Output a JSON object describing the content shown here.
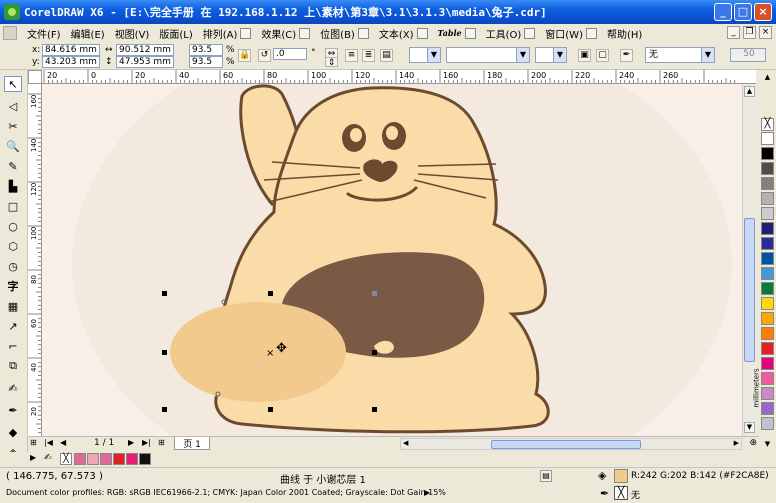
{
  "title": "CorelDRAW X6 - [E:\\完全手册 在 192.168.1.12 上\\素材\\第3章\\3.1\\3.1.3\\media\\兔子.cdr]",
  "window_buttons": {
    "minimize": "_",
    "maximize": "□",
    "close": "×"
  },
  "menu": [
    {
      "label": "文件(F)"
    },
    {
      "label": "编辑(E)"
    },
    {
      "label": "视图(V)"
    },
    {
      "label": "版面(L)"
    },
    {
      "label": "排列(A)"
    },
    {
      "label": "效果(C)"
    },
    {
      "label": "位图(B)"
    },
    {
      "label": "文本(X)"
    },
    {
      "label": "Table"
    },
    {
      "label": "工具(O)"
    },
    {
      "label": "窗口(W)"
    },
    {
      "label": "帮助(H)"
    }
  ],
  "propbar": {
    "x_label": "x:",
    "x_value": "84.616 mm",
    "y_label": "y:",
    "y_value": "43.203 mm",
    "w_value": "90.512 mm",
    "h_value": "47.953 mm",
    "scale_w": "93.5",
    "scale_h": "93.5",
    "percent": "%",
    "angle": ".0",
    "degree": "°",
    "outline_none": "无",
    "size_value": "50"
  },
  "ruler": {
    "h_ticks": [
      "20",
      "0",
      "20",
      "40",
      "60",
      "80",
      "100",
      "120",
      "140",
      "160",
      "180",
      "200",
      "220",
      "240",
      "260"
    ],
    "v_ticks": [
      "160",
      "140",
      "120",
      "100",
      "80",
      "60",
      "40",
      "20"
    ],
    "unit": "millimeters"
  },
  "pages": {
    "current": "1 / 1",
    "tab": "页 1"
  },
  "status": {
    "coords": "( 146.775, 67.573 )",
    "selection": "曲线 于 小谢芯层 1",
    "fill_info": "R:242 G:202 B:142 (#F2CA8E)",
    "outline_none": "无",
    "profile": "Document color profiles: RGB: sRGB IEC61966-2.1; CMYK: Japan Color 2001 Coated; Grayscale: Dot Gain 15%"
  },
  "colors": {
    "bunny_fill": "#f9dca7",
    "bunny_outline": "#6b4a2f",
    "belly": "#7a5a45",
    "selected_ellipse": "#f2ca8e",
    "paper_bg": "#f6ebe0",
    "titlebar": "#0d5fe0"
  },
  "palette_colors": [
    "#ffffff",
    "#000000",
    "#4d4d4d",
    "#808080",
    "#b3b3b3",
    "#cccccc",
    "#1f1f7a",
    "#2b2b9a",
    "#0052a3",
    "#3f9ad6",
    "#0a7a3a",
    "#ffd800",
    "#ffa800",
    "#ff7d00",
    "#e61e28",
    "#e6007a",
    "#f05aa0",
    "#c98ac8",
    "#9966cc",
    "#c0c0d0"
  ],
  "document_swatches": [
    "#d96b95",
    "#eea6b5",
    "#e0689a",
    "#e31e24",
    "#e61e78",
    "#111111"
  ]
}
